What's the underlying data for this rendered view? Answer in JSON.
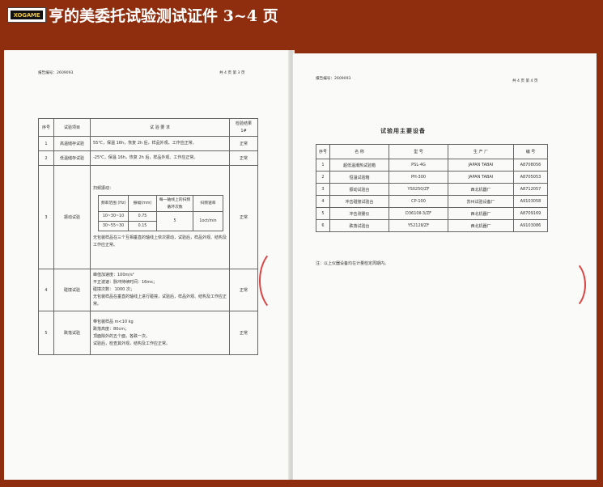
{
  "header": {
    "logo_text": "XOGAME",
    "title": "亨的美委托试验测试证件 3~4 页"
  },
  "left_page": {
    "report_no": "报告编号：2609093",
    "page_no": "共 4 页 第 3 页",
    "columns": [
      "序号",
      "试验项目",
      "试 验 要 求",
      "检验结果"
    ],
    "result_sub": "1#",
    "rows": [
      {
        "no": "1",
        "item": "高温储存试验",
        "req": "55℃，保温 16h，恢复 2h 后，样品外观、工作应正常。",
        "result": "正常"
      },
      {
        "no": "2",
        "item": "低温储存试验",
        "req": "-25℃，保温 16h，恢复 2h 后，样品外观、工作应正常。",
        "result": "正常"
      },
      {
        "no": "3",
        "item": "振动试验",
        "req_title": "扫频振动：",
        "vib_head": [
          "频率范围 (Hz)",
          "振幅(mm)",
          "每一轴线上的扫频循环次数",
          "扫频速率"
        ],
        "vib_rows": [
          [
            "10~30~10",
            "0.75"
          ],
          [
            "30~55~30",
            "0.15"
          ]
        ],
        "vib_cycles": "5",
        "vib_rate": "1oct/min",
        "req_tail": "无包装样品在三个互相垂直的轴线上依次振动，试验后，样品外观、结构及工作应正常。",
        "result": "正常"
      },
      {
        "no": "4",
        "item": "碰撞试验",
        "req_lines": [
          "峰值加速度：100m/s²",
          "平正波速：脉冲持续时间：16ms；",
          "碰撞次数：  1000 次；",
          "无包装样品在垂直的轴线上进行碰撞，试验后，样品外观、结构及工作应正常。"
        ],
        "result": "正常"
      },
      {
        "no": "5",
        "item": "跌落试验",
        "req_lines": [
          "带包装样品 m<10 kg",
          "跌落高度：80cm；",
          "顶面除外的五个面，各跌一次。",
          "试验后，检查其外观，结构及工作应正常。"
        ],
        "result": "正常"
      }
    ]
  },
  "right_page": {
    "report_no": "报告编号：2609093",
    "page_no": "共 4 页 第 4 页",
    "heading": "试验用主要设备",
    "columns": [
      "序号",
      "名 称",
      "型 号",
      "生 产 厂",
      "编 号"
    ],
    "rows": [
      [
        "1",
        "超低温潮热试验箱",
        "PSL-4G",
        "JAPAN  TABAI",
        "A8708056"
      ],
      [
        "2",
        "恒温试验箱",
        "PH-300",
        "JAPAN  TABAI",
        "A8705053"
      ],
      [
        "3",
        "振动试验台",
        "YS0250/ZF",
        "西北机器厂",
        "A8712057"
      ],
      [
        "4",
        "冲击碰撞试验台",
        "CP-100",
        "苏州试验设备厂",
        "A9103058"
      ],
      [
        "5",
        "冲击测量仪",
        "D3610Ⅱ-3/ZF",
        "西北机器厂",
        "A8709169"
      ],
      [
        "6",
        "跌落试验台",
        "Y5212Ⅱ/ZF",
        "西北机器厂",
        "A9103086"
      ]
    ],
    "note": "注：以上仪器设备均在计量检定周期内。"
  },
  "colors": {
    "background": "#8e2e0f",
    "stamp": "#d44444"
  }
}
